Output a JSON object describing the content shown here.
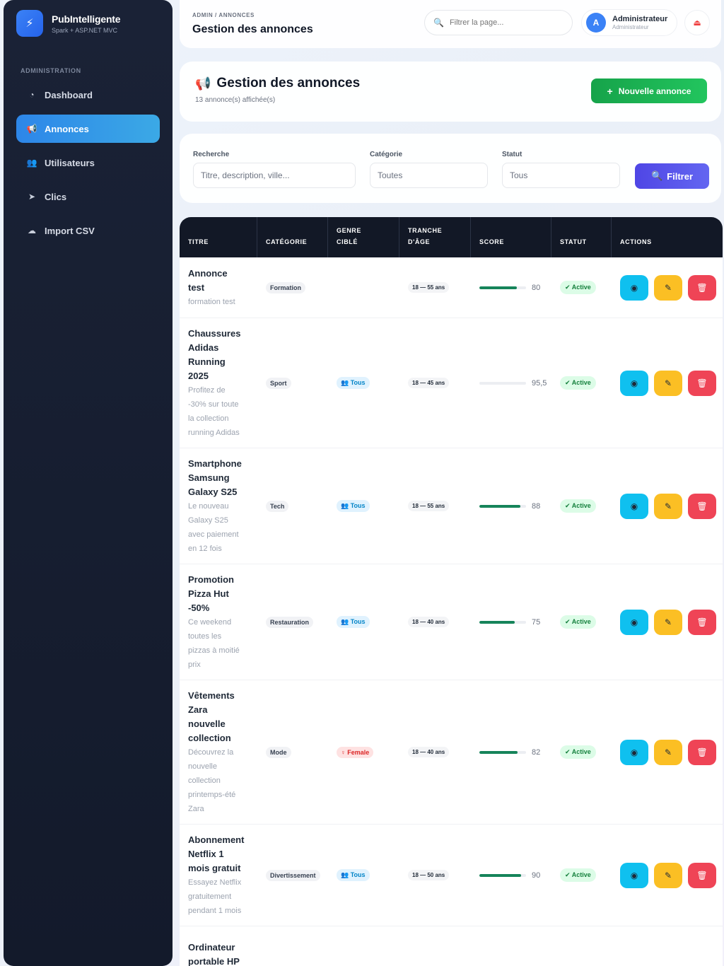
{
  "brand": {
    "name": "PubIntelligente",
    "subtitle": "Spark + ASP.NET MVC",
    "logo_icon": "bolt-icon"
  },
  "sidebar": {
    "section": "ADMINISTRATION",
    "items": [
      {
        "label": "Dashboard",
        "icon": "chart-pie-icon",
        "glyph": "◔",
        "active": false
      },
      {
        "label": "Annonces",
        "icon": "megaphone-icon",
        "glyph": "📢",
        "active": true
      },
      {
        "label": "Utilisateurs",
        "icon": "users-icon",
        "glyph": "👥",
        "active": false
      },
      {
        "label": "Clics",
        "icon": "pointer-icon",
        "glyph": "➤",
        "active": false
      },
      {
        "label": "Import CSV",
        "icon": "cloud-upload-icon",
        "glyph": "☁",
        "active": false
      }
    ]
  },
  "topbar": {
    "breadcrumb": "ADMIN / ANNONCES",
    "title": "Gestion des annonces",
    "search_placeholder": "Filtrer la page...",
    "user_initial": "A",
    "user_name": "Administrateur",
    "user_role": "Administrateur"
  },
  "header": {
    "title": "Gestion des annonces",
    "subtitle": "13 annonce(s) affichée(s)",
    "new_button": "Nouvelle annonce"
  },
  "filters": {
    "search_label": "Recherche",
    "search_placeholder": "Titre, description, ville...",
    "category_label": "Catégorie",
    "category_value": "Toutes",
    "status_label": "Statut",
    "status_value": "Tous",
    "filter_button": "Filtrer"
  },
  "table": {
    "headers": {
      "title": "TITRE",
      "category": "CATÉGORIE",
      "gender_1": "GENRE",
      "gender_2": "CIBLÉ",
      "age_1": "TRANCHE",
      "age_2": "D'ÂGE",
      "score": "SCORE",
      "status": "STATUT",
      "actions": "ACTIONS"
    },
    "rows": [
      {
        "title": [
          "Annonce",
          "test"
        ],
        "desc": [
          "formation test"
        ],
        "category": "Formation",
        "gender": "",
        "gender_type": "none",
        "age": "18 — 55 ans",
        "score": "80",
        "score_pct": 80,
        "status": "✔ Active",
        "height": 86
      },
      {
        "title": [
          "Chaussures",
          "Adidas",
          "Running",
          "2025"
        ],
        "desc": [
          "Profitez de",
          "-30% sur toute",
          "la collection",
          "running Adidas"
        ],
        "category": "Sport",
        "gender": "👥 Tous",
        "gender_type": "tous",
        "age": "18 — 45 ans",
        "score": "95,5",
        "score_pct": 0,
        "status": "✔ Active",
        "height": 184
      },
      {
        "title": [
          "Smartphone",
          "Samsung",
          "Galaxy S25"
        ],
        "desc": [
          "Le nouveau",
          "Galaxy S25",
          "avec paiement",
          "en 12 fois"
        ],
        "category": "Tech",
        "gender": "👥 Tous",
        "gender_type": "tous",
        "age": "18 — 55 ans",
        "score": "88",
        "score_pct": 88,
        "status": "✔ Active",
        "height": 164
      },
      {
        "title": [
          "Promotion",
          "Pizza Hut",
          "-50%"
        ],
        "desc": [
          "Ce weekend",
          "toutes les",
          "pizzas à moitié",
          "prix"
        ],
        "category": "Restauration",
        "gender": "👥 Tous",
        "gender_type": "tous",
        "age": "18 — 40 ans",
        "score": "75",
        "score_pct": 75,
        "status": "✔ Active",
        "height": 164
      },
      {
        "title": [
          "Vêtements",
          "Zara",
          "nouvelle",
          "collection"
        ],
        "desc": [
          "Découvrez la",
          "nouvelle",
          "collection",
          "printemps-été",
          "Zara"
        ],
        "category": "Mode",
        "gender": "♀ Female",
        "gender_type": "fem",
        "age": "18 — 40 ans",
        "score": "82",
        "score_pct": 82,
        "status": "✔ Active",
        "height": 204
      },
      {
        "title": [
          "Abonnement",
          "Netflix 1",
          "mois gratuit"
        ],
        "desc": [
          "Essayez Netflix",
          "gratuitement",
          "pendant 1 mois"
        ],
        "category": "Divertissement",
        "gender": "👥 Tous",
        "gender_type": "tous",
        "age": "18 — 50 ans",
        "score": "90",
        "score_pct": 90,
        "status": "✔ Active",
        "height": 144
      },
      {
        "title": [
          "Ordinateur",
          "portable HP"
        ],
        "desc": [],
        "category": "",
        "gender": "",
        "gender_type": "none",
        "age": "",
        "score": "",
        "score_pct": 0,
        "status": "",
        "height": 80,
        "partial": true
      }
    ]
  },
  "colors": {
    "accent": "#2d86e8",
    "success": "#16a34a",
    "primary": "#4f46e5",
    "danger": "#ef4456",
    "warning": "#fbbf24",
    "info": "#0fc0ef"
  }
}
